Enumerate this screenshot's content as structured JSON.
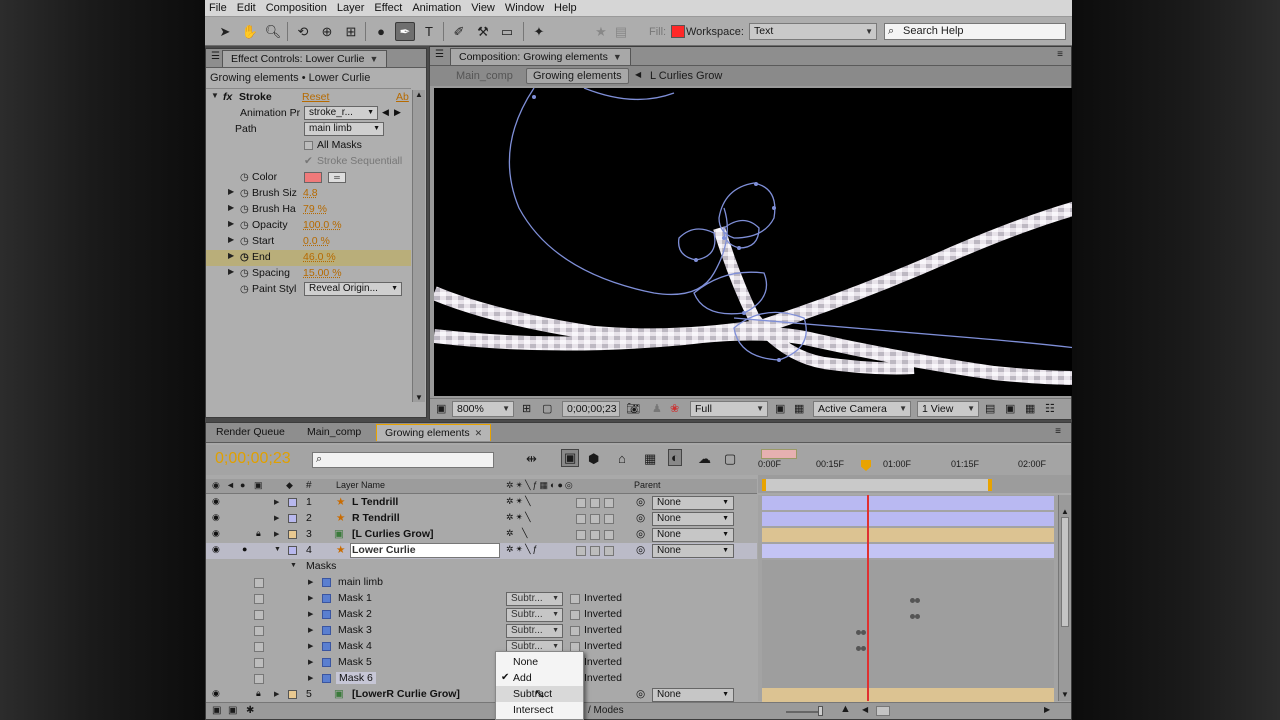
{
  "menu": [
    "File",
    "Edit",
    "Composition",
    "Layer",
    "Effect",
    "Animation",
    "View",
    "Window",
    "Help"
  ],
  "toolbar": {
    "fill_label": "Fill:",
    "fill_color": "#ff2828",
    "workspace_label": "Workspace:",
    "workspace_value": "Text",
    "search_placeholder": "Search Help"
  },
  "effect_controls": {
    "tab": "Effect Controls: Lower Curlie",
    "subtitle": "Growing elements • Lower Curlie",
    "effect_name": "Stroke",
    "reset": "Reset",
    "about": "Ab",
    "anim_label": "Animation Pr",
    "anim_value": "stroke_r...",
    "path_label": "Path",
    "path_value": "main limb",
    "all_masks": "All Masks",
    "stroke_seq": "Stroke Sequentiall",
    "color_label": "Color",
    "stroke_color": "#f07a7a",
    "props": [
      {
        "label": "Brush Siz",
        "value": "4.8"
      },
      {
        "label": "Brush Ha",
        "value": "79 %"
      },
      {
        "label": "Opacity",
        "value": "100.0 %"
      },
      {
        "label": "Start",
        "value": "0.0 %"
      },
      {
        "label": "End",
        "value": "46.0 %"
      },
      {
        "label": "Spacing",
        "value": "15.00 %"
      }
    ],
    "paint_label": "Paint Styl",
    "paint_value": "Reveal Origin..."
  },
  "composition": {
    "tab": "Composition: Growing elements",
    "crumbs": [
      "Main_comp",
      "Growing elements",
      "L Curlies Grow"
    ],
    "zoom": "800%",
    "timecode": "0;00;00;23",
    "resolution": "Full",
    "camera": "Active Camera",
    "views": "1 View"
  },
  "timeline": {
    "tabs": [
      "Render Queue",
      "Main_comp",
      "Growing elements"
    ],
    "current_time": "0;00;00;23",
    "search_placeholder": "",
    "col_hash": "#",
    "col_layer": "Layer Name",
    "col_parent": "Parent",
    "ruler": [
      "0:00F",
      "00:15F",
      "01:00F",
      "01:15F",
      "02:00F"
    ],
    "layers": [
      {
        "num": "1",
        "name": "L Tendrill",
        "parent": "None",
        "label_color": "#b8b8ee"
      },
      {
        "num": "2",
        "name": "R Tendrill",
        "parent": "None",
        "label_color": "#b8b8ee"
      },
      {
        "num": "3",
        "name": "[L Curlies Grow]",
        "parent": "None",
        "label_color": "#e8c890"
      },
      {
        "num": "4",
        "name": "Lower Curlie",
        "parent": "None",
        "label_color": "#b8b8ee"
      },
      {
        "num": "5",
        "name": "[LowerR Curlie Grow]",
        "parent": "None",
        "label_color": "#e8c890"
      }
    ],
    "masks_label": "Masks",
    "masks": [
      {
        "name": "main limb",
        "mode": "",
        "inverted": ""
      },
      {
        "name": "Mask 1",
        "mode": "Subtr...",
        "inverted": "Inverted"
      },
      {
        "name": "Mask 2",
        "mode": "Subtr...",
        "inverted": "Inverted"
      },
      {
        "name": "Mask 3",
        "mode": "Subtr...",
        "inverted": "Inverted"
      },
      {
        "name": "Mask 4",
        "mode": "Subtr...",
        "inverted": "Inverted"
      },
      {
        "name": "Mask 5",
        "mode": "",
        "inverted": "Inverted"
      },
      {
        "name": "Mask 6",
        "mode": "",
        "inverted": "Inverted"
      }
    ],
    "toggle_modes": "/ Modes"
  },
  "popup": {
    "items": [
      "None",
      "Add",
      "Subtract",
      "Intersect"
    ],
    "checked": "Add",
    "hovered": "Subtract"
  }
}
